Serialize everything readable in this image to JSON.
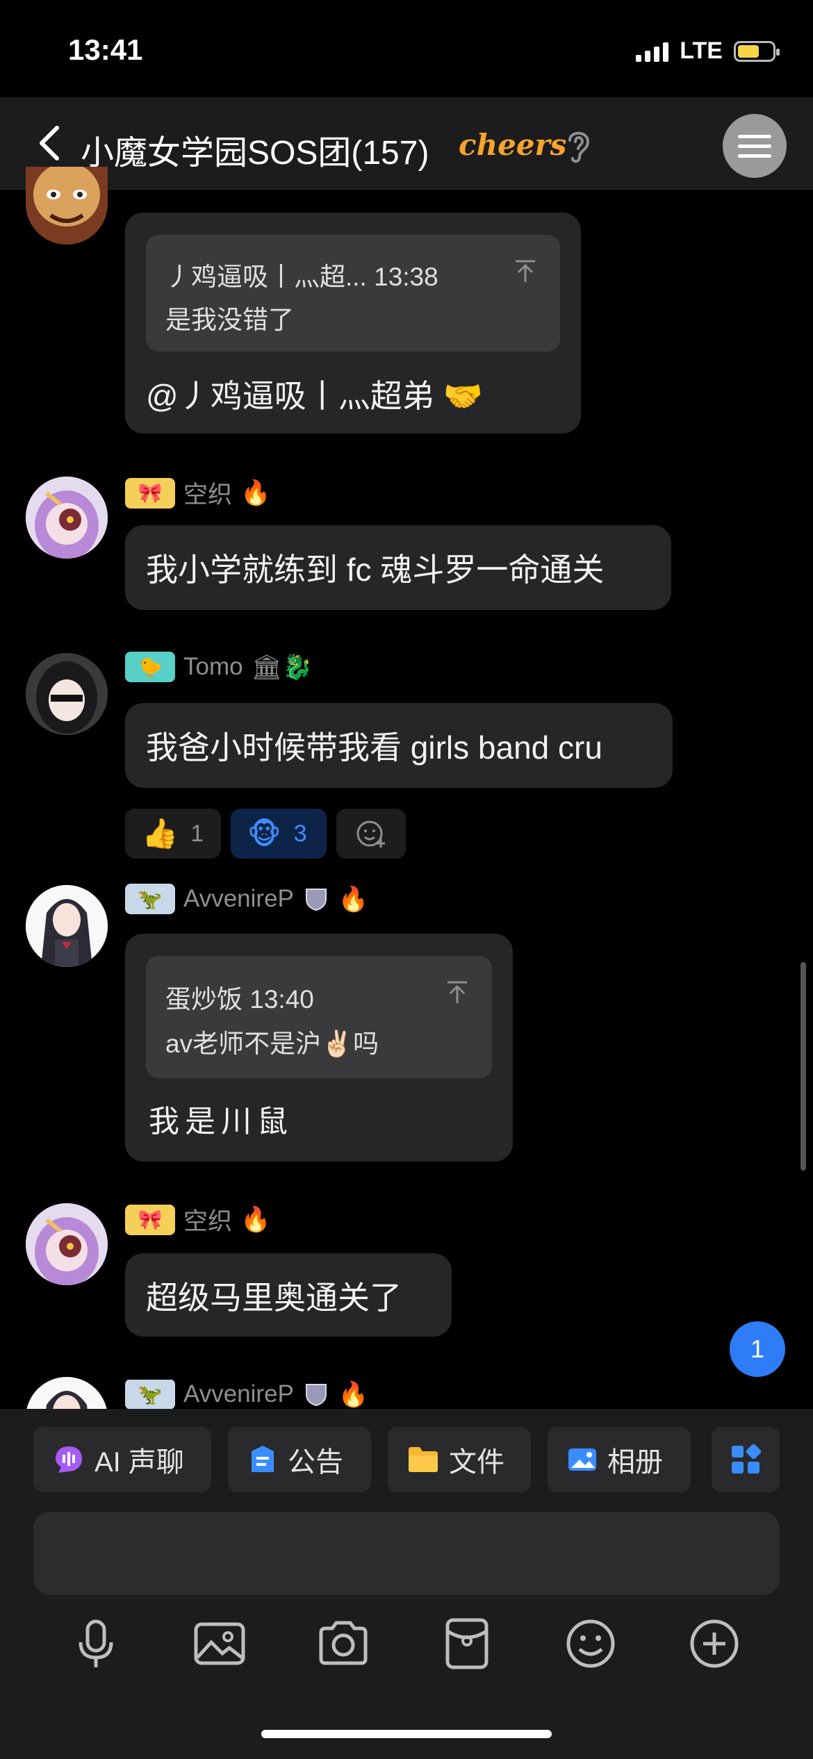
{
  "status": {
    "time": "13:41",
    "network": "LTE"
  },
  "header": {
    "title": "小魔女学园SOS团(157)",
    "badge": "cheers"
  },
  "messages": {
    "m1": {
      "quote_author": "丿鸡逼吸丨灬超... 13:38",
      "quote_text": "是我没错了",
      "text": "@丿鸡逼吸丨灬超弟 🤝"
    },
    "m2": {
      "tag": "🎀",
      "name": "空织",
      "flair": "🔥",
      "text": "我小学就练到 fc 魂斗罗一命通关"
    },
    "m3": {
      "tag": "🐤",
      "name": "Tomo",
      "flair": "🏛🐉",
      "text": "我爸小时候带我看 girls band cru",
      "reactions": [
        {
          "emoji": "👍",
          "count": "1"
        },
        {
          "emoji": "🐵",
          "count": "3"
        }
      ]
    },
    "m4": {
      "tag": "🦖",
      "name": "AvvenireP",
      "flair": "🔥",
      "quote_author": "蛋炒饭 13:40",
      "quote_text": "av老师不是沪✌🏻吗",
      "text": "我是川鼠"
    },
    "m5": {
      "tag": "🎀",
      "name": "空织",
      "flair": "🔥",
      "text": "超级马里奥通关了"
    },
    "m6": {
      "tag": "🦖",
      "name": "AvvenireP",
      "flair": "🔥"
    }
  },
  "unread_count": "1",
  "toolbar": {
    "ai_voice": "AI 声聊",
    "announcement": "公告",
    "files": "文件",
    "album": "相册"
  },
  "colors": {
    "accent": "#2f7df6",
    "background": "#000000",
    "bubble": "#262628"
  }
}
